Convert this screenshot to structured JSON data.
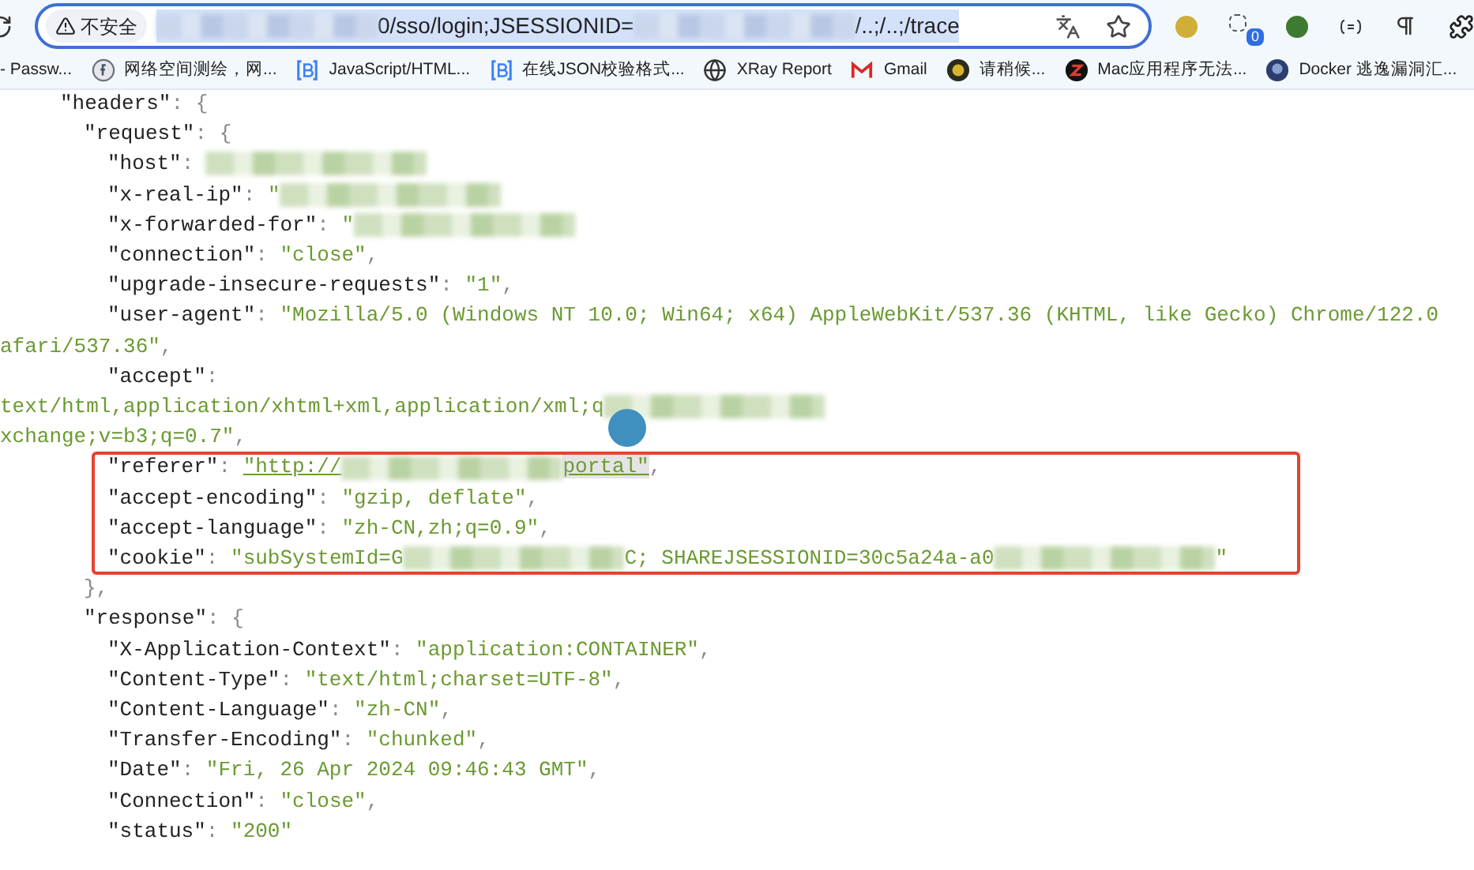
{
  "browser": {
    "security_label": "不安全",
    "url_selected": true,
    "extension_badge": "0",
    "url_parts": [
      {
        "kind": "blur"
      },
      {
        "kind": "text",
        "text": "0/sso/login;JSESSIONID="
      },
      {
        "kind": "blur"
      },
      {
        "kind": "text",
        "text": "/..;/..;/trace"
      }
    ]
  },
  "bookmarks": [
    {
      "label": "- Passw..."
    },
    {
      "label": "网络空间测绘，网..."
    },
    {
      "label": "JavaScript/HTML..."
    },
    {
      "label": "在线JSON校验格式..."
    },
    {
      "label": "XRay Report"
    },
    {
      "label": "Gmail"
    },
    {
      "label": "请稍候..."
    },
    {
      "label": "Mac应用程序无法..."
    },
    {
      "label": "Docker 逃逸漏洞汇..."
    }
  ],
  "annotation_box": true,
  "code_lines": [
    {
      "kind": "outer",
      "tokens": [
        {
          "kind": "key",
          "text": "\"headers\""
        },
        {
          "kind": "punct",
          "text": ": {"
        }
      ]
    },
    {
      "kind": "section",
      "tokens": [
        {
          "kind": "key",
          "text": "\"request\""
        },
        {
          "kind": "punct",
          "text": ": {"
        }
      ]
    },
    {
      "kind": "entry",
      "tokens": [
        {
          "kind": "key",
          "text": "\"host\""
        },
        {
          "kind": "punct",
          "text": ": "
        },
        {
          "kind": "blur"
        }
      ]
    },
    {
      "kind": "entry",
      "tokens": [
        {
          "kind": "key",
          "text": "\"x-real-ip\""
        },
        {
          "kind": "punct",
          "text": ": "
        },
        {
          "kind": "string",
          "text": "\""
        },
        {
          "kind": "blur"
        }
      ]
    },
    {
      "kind": "entry",
      "tokens": [
        {
          "kind": "key",
          "text": "\"x-forwarded-for\""
        },
        {
          "kind": "punct",
          "text": ": "
        },
        {
          "kind": "string",
          "text": "\""
        },
        {
          "kind": "blur"
        }
      ]
    },
    {
      "kind": "entry",
      "tokens": [
        {
          "kind": "key",
          "text": "\"connection\""
        },
        {
          "kind": "punct",
          "text": ": "
        },
        {
          "kind": "string",
          "text": "\"close\""
        },
        {
          "kind": "punct",
          "text": ","
        }
      ]
    },
    {
      "kind": "entry",
      "tokens": [
        {
          "kind": "key",
          "text": "\"upgrade-insecure-requests\""
        },
        {
          "kind": "punct",
          "text": ": "
        },
        {
          "kind": "string",
          "text": "\"1\""
        },
        {
          "kind": "punct",
          "text": ","
        }
      ]
    },
    {
      "kind": "entry",
      "tokens": [
        {
          "kind": "key",
          "text": "\"user-agent\""
        },
        {
          "kind": "punct",
          "text": ": "
        },
        {
          "kind": "string",
          "text": "\"Mozilla/5.0 (Windows NT 10.0; Win64; x64) AppleWebKit/537.36 (KHTML, like Gecko) Chrome/122.0"
        }
      ]
    },
    {
      "kind": "continuation",
      "tokens": [
        {
          "kind": "string",
          "text": "afari/537.36\""
        },
        {
          "kind": "punct",
          "text": ","
        }
      ]
    },
    {
      "kind": "entry",
      "tokens": [
        {
          "kind": "key",
          "text": "\"accept\""
        },
        {
          "kind": "punct",
          "text": ":"
        }
      ]
    },
    {
      "kind": "continuation",
      "tokens": [
        {
          "kind": "string",
          "text": "text/html,application/xhtml+xml,application/xml;q"
        },
        {
          "kind": "blur"
        }
      ]
    },
    {
      "kind": "continuation",
      "tokens": [
        {
          "kind": "string",
          "text": "xchange;v=b3;q=0.7\""
        },
        {
          "kind": "punct",
          "text": ","
        }
      ]
    },
    {
      "kind": "entry",
      "tokens": [
        {
          "kind": "key",
          "text": "\"referer\""
        },
        {
          "kind": "punct",
          "text": ": "
        },
        {
          "kind": "link",
          "text": "\"http://",
          "selected": false
        },
        {
          "kind": "blur"
        },
        {
          "kind": "link",
          "text": "portal\"",
          "selected": true
        },
        {
          "kind": "punct",
          "text": ","
        }
      ]
    },
    {
      "kind": "entry",
      "tokens": [
        {
          "kind": "key",
          "text": "\"accept-encoding\""
        },
        {
          "kind": "punct",
          "text": ": "
        },
        {
          "kind": "string",
          "text": "\"gzip, deflate\""
        },
        {
          "kind": "punct",
          "text": ","
        }
      ]
    },
    {
      "kind": "entry",
      "tokens": [
        {
          "kind": "key",
          "text": "\"accept-language\""
        },
        {
          "kind": "punct",
          "text": ": "
        },
        {
          "kind": "string",
          "text": "\"zh-CN,zh;q=0.9\""
        },
        {
          "kind": "punct",
          "text": ","
        }
      ]
    },
    {
      "kind": "entry",
      "tokens": [
        {
          "kind": "key",
          "text": "\"cookie\""
        },
        {
          "kind": "punct",
          "text": ": "
        },
        {
          "kind": "string",
          "text": "\"subSystemId=G"
        },
        {
          "kind": "blur"
        },
        {
          "kind": "string",
          "text": "C; SHAREJSESSIONID=30c5a24a-a0"
        },
        {
          "kind": "blur"
        },
        {
          "kind": "string",
          "text": "\""
        }
      ]
    },
    {
      "kind": "section",
      "tokens": [
        {
          "kind": "punct",
          "text": "},"
        }
      ]
    },
    {
      "kind": "section",
      "tokens": [
        {
          "kind": "key",
          "text": "\"response\""
        },
        {
          "kind": "punct",
          "text": ": {"
        }
      ]
    },
    {
      "kind": "entry",
      "tokens": [
        {
          "kind": "key",
          "text": "\"X-Application-Context\""
        },
        {
          "kind": "punct",
          "text": ": "
        },
        {
          "kind": "string",
          "text": "\"application:CONTAINER\""
        },
        {
          "kind": "punct",
          "text": ","
        }
      ]
    },
    {
      "kind": "entry",
      "tokens": [
        {
          "kind": "key",
          "text": "\"Content-Type\""
        },
        {
          "kind": "punct",
          "text": ": "
        },
        {
          "kind": "string",
          "text": "\"text/html;charset=UTF-8\""
        },
        {
          "kind": "punct",
          "text": ","
        }
      ]
    },
    {
      "kind": "entry",
      "tokens": [
        {
          "kind": "key",
          "text": "\"Content-Language\""
        },
        {
          "kind": "punct",
          "text": ": "
        },
        {
          "kind": "string",
          "text": "\"zh-CN\""
        },
        {
          "kind": "punct",
          "text": ","
        }
      ]
    },
    {
      "kind": "entry",
      "tokens": [
        {
          "kind": "key",
          "text": "\"Transfer-Encoding\""
        },
        {
          "kind": "punct",
          "text": ": "
        },
        {
          "kind": "string",
          "text": "\"chunked\""
        },
        {
          "kind": "punct",
          "text": ","
        }
      ]
    },
    {
      "kind": "entry",
      "tokens": [
        {
          "kind": "key",
          "text": "\"Date\""
        },
        {
          "kind": "punct",
          "text": ": "
        },
        {
          "kind": "string",
          "text": "\"Fri, 26 Apr 2024 09:46:43 GMT\""
        },
        {
          "kind": "punct",
          "text": ","
        }
      ]
    },
    {
      "kind": "entry",
      "tokens": [
        {
          "kind": "key",
          "text": "\"Connection\""
        },
        {
          "kind": "punct",
          "text": ": "
        },
        {
          "kind": "string",
          "text": "\"close\""
        },
        {
          "kind": "punct",
          "text": ","
        }
      ]
    },
    {
      "kind": "entry",
      "tokens": [
        {
          "kind": "key",
          "text": "\"status\""
        },
        {
          "kind": "punct",
          "text": ": "
        },
        {
          "kind": "string",
          "text": "\"200\""
        }
      ]
    }
  ]
}
